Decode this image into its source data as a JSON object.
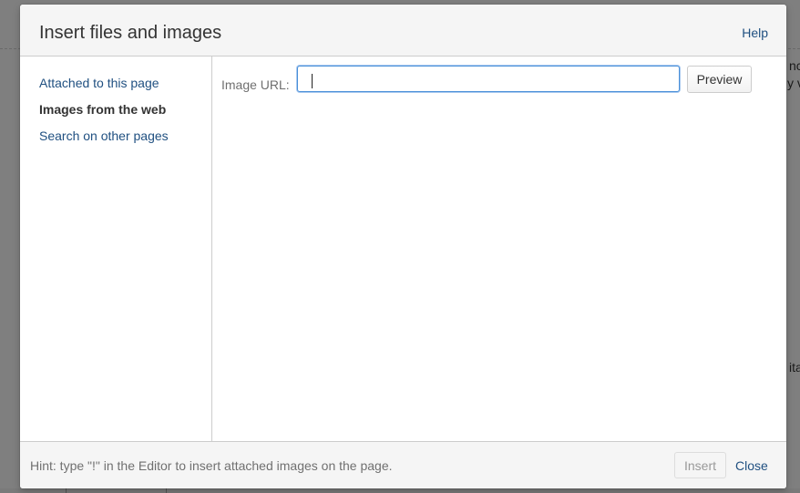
{
  "background": {
    "fragments": [
      "nc",
      "y v",
      "ita"
    ]
  },
  "dialog": {
    "title": "Insert files and images",
    "help_label": "Help"
  },
  "sidebar": {
    "items": [
      {
        "label": "Attached to this page",
        "active": false
      },
      {
        "label": "Images from the web",
        "active": true
      },
      {
        "label": "Search on other pages",
        "active": false
      }
    ]
  },
  "main": {
    "url_label": "Image URL:",
    "url_value": "",
    "preview_label": "Preview"
  },
  "footer": {
    "hint": "Hint: type \"!\" in the Editor to insert attached images on the page.",
    "insert_label": "Insert",
    "insert_disabled": true,
    "close_label": "Close"
  },
  "colors": {
    "link": "#205081",
    "focus_border": "#4a90d9",
    "overlay": "#7f7f7f"
  }
}
